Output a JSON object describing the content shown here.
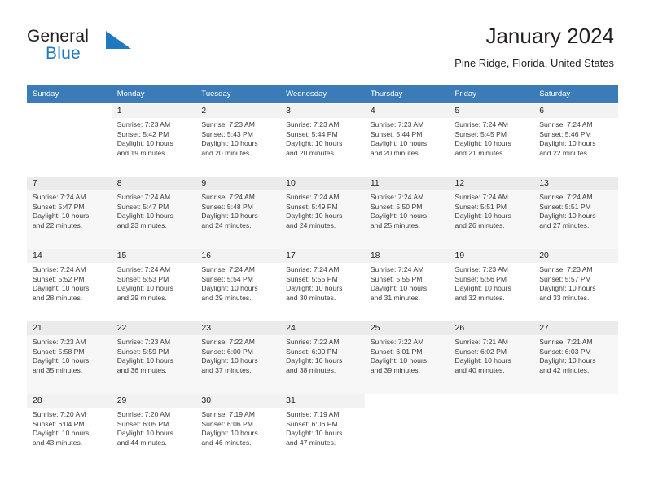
{
  "brand": {
    "name_part1": "General",
    "name_part2": "Blue",
    "flag_icon": "flag-triangle-icon",
    "accent_color": "#1f79c0"
  },
  "header": {
    "title": "January 2024",
    "subtitle": "Pine Ridge, Florida, United States"
  },
  "calendar": {
    "header_bg": "#3b7cb8",
    "weekdays": [
      "Sunday",
      "Monday",
      "Tuesday",
      "Wednesday",
      "Thursday",
      "Friday",
      "Saturday"
    ],
    "weeks": [
      [
        {
          "day": "",
          "sunrise": "",
          "sunset": "",
          "daylight1": "",
          "daylight2": ""
        },
        {
          "day": "1",
          "sunrise": "Sunrise: 7:23 AM",
          "sunset": "Sunset: 5:42 PM",
          "daylight1": "Daylight: 10 hours",
          "daylight2": "and 19 minutes."
        },
        {
          "day": "2",
          "sunrise": "Sunrise: 7:23 AM",
          "sunset": "Sunset: 5:43 PM",
          "daylight1": "Daylight: 10 hours",
          "daylight2": "and 20 minutes."
        },
        {
          "day": "3",
          "sunrise": "Sunrise: 7:23 AM",
          "sunset": "Sunset: 5:44 PM",
          "daylight1": "Daylight: 10 hours",
          "daylight2": "and 20 minutes."
        },
        {
          "day": "4",
          "sunrise": "Sunrise: 7:23 AM",
          "sunset": "Sunset: 5:44 PM",
          "daylight1": "Daylight: 10 hours",
          "daylight2": "and 20 minutes."
        },
        {
          "day": "5",
          "sunrise": "Sunrise: 7:24 AM",
          "sunset": "Sunset: 5:45 PM",
          "daylight1": "Daylight: 10 hours",
          "daylight2": "and 21 minutes."
        },
        {
          "day": "6",
          "sunrise": "Sunrise: 7:24 AM",
          "sunset": "Sunset: 5:46 PM",
          "daylight1": "Daylight: 10 hours",
          "daylight2": "and 22 minutes."
        }
      ],
      [
        {
          "day": "7",
          "sunrise": "Sunrise: 7:24 AM",
          "sunset": "Sunset: 5:47 PM",
          "daylight1": "Daylight: 10 hours",
          "daylight2": "and 22 minutes."
        },
        {
          "day": "8",
          "sunrise": "Sunrise: 7:24 AM",
          "sunset": "Sunset: 5:47 PM",
          "daylight1": "Daylight: 10 hours",
          "daylight2": "and 23 minutes."
        },
        {
          "day": "9",
          "sunrise": "Sunrise: 7:24 AM",
          "sunset": "Sunset: 5:48 PM",
          "daylight1": "Daylight: 10 hours",
          "daylight2": "and 24 minutes."
        },
        {
          "day": "10",
          "sunrise": "Sunrise: 7:24 AM",
          "sunset": "Sunset: 5:49 PM",
          "daylight1": "Daylight: 10 hours",
          "daylight2": "and 24 minutes."
        },
        {
          "day": "11",
          "sunrise": "Sunrise: 7:24 AM",
          "sunset": "Sunset: 5:50 PM",
          "daylight1": "Daylight: 10 hours",
          "daylight2": "and 25 minutes."
        },
        {
          "day": "12",
          "sunrise": "Sunrise: 7:24 AM",
          "sunset": "Sunset: 5:51 PM",
          "daylight1": "Daylight: 10 hours",
          "daylight2": "and 26 minutes."
        },
        {
          "day": "13",
          "sunrise": "Sunrise: 7:24 AM",
          "sunset": "Sunset: 5:51 PM",
          "daylight1": "Daylight: 10 hours",
          "daylight2": "and 27 minutes."
        }
      ],
      [
        {
          "day": "14",
          "sunrise": "Sunrise: 7:24 AM",
          "sunset": "Sunset: 5:52 PM",
          "daylight1": "Daylight: 10 hours",
          "daylight2": "and 28 minutes."
        },
        {
          "day": "15",
          "sunrise": "Sunrise: 7:24 AM",
          "sunset": "Sunset: 5:53 PM",
          "daylight1": "Daylight: 10 hours",
          "daylight2": "and 29 minutes."
        },
        {
          "day": "16",
          "sunrise": "Sunrise: 7:24 AM",
          "sunset": "Sunset: 5:54 PM",
          "daylight1": "Daylight: 10 hours",
          "daylight2": "and 29 minutes."
        },
        {
          "day": "17",
          "sunrise": "Sunrise: 7:24 AM",
          "sunset": "Sunset: 5:55 PM",
          "daylight1": "Daylight: 10 hours",
          "daylight2": "and 30 minutes."
        },
        {
          "day": "18",
          "sunrise": "Sunrise: 7:24 AM",
          "sunset": "Sunset: 5:55 PM",
          "daylight1": "Daylight: 10 hours",
          "daylight2": "and 31 minutes."
        },
        {
          "day": "19",
          "sunrise": "Sunrise: 7:23 AM",
          "sunset": "Sunset: 5:56 PM",
          "daylight1": "Daylight: 10 hours",
          "daylight2": "and 32 minutes."
        },
        {
          "day": "20",
          "sunrise": "Sunrise: 7:23 AM",
          "sunset": "Sunset: 5:57 PM",
          "daylight1": "Daylight: 10 hours",
          "daylight2": "and 33 minutes."
        }
      ],
      [
        {
          "day": "21",
          "sunrise": "Sunrise: 7:23 AM",
          "sunset": "Sunset: 5:58 PM",
          "daylight1": "Daylight: 10 hours",
          "daylight2": "and 35 minutes."
        },
        {
          "day": "22",
          "sunrise": "Sunrise: 7:23 AM",
          "sunset": "Sunset: 5:59 PM",
          "daylight1": "Daylight: 10 hours",
          "daylight2": "and 36 minutes."
        },
        {
          "day": "23",
          "sunrise": "Sunrise: 7:22 AM",
          "sunset": "Sunset: 6:00 PM",
          "daylight1": "Daylight: 10 hours",
          "daylight2": "and 37 minutes."
        },
        {
          "day": "24",
          "sunrise": "Sunrise: 7:22 AM",
          "sunset": "Sunset: 6:00 PM",
          "daylight1": "Daylight: 10 hours",
          "daylight2": "and 38 minutes."
        },
        {
          "day": "25",
          "sunrise": "Sunrise: 7:22 AM",
          "sunset": "Sunset: 6:01 PM",
          "daylight1": "Daylight: 10 hours",
          "daylight2": "and 39 minutes."
        },
        {
          "day": "26",
          "sunrise": "Sunrise: 7:21 AM",
          "sunset": "Sunset: 6:02 PM",
          "daylight1": "Daylight: 10 hours",
          "daylight2": "and 40 minutes."
        },
        {
          "day": "27",
          "sunrise": "Sunrise: 7:21 AM",
          "sunset": "Sunset: 6:03 PM",
          "daylight1": "Daylight: 10 hours",
          "daylight2": "and 42 minutes."
        }
      ],
      [
        {
          "day": "28",
          "sunrise": "Sunrise: 7:20 AM",
          "sunset": "Sunset: 6:04 PM",
          "daylight1": "Daylight: 10 hours",
          "daylight2": "and 43 minutes."
        },
        {
          "day": "29",
          "sunrise": "Sunrise: 7:20 AM",
          "sunset": "Sunset: 6:05 PM",
          "daylight1": "Daylight: 10 hours",
          "daylight2": "and 44 minutes."
        },
        {
          "day": "30",
          "sunrise": "Sunrise: 7:19 AM",
          "sunset": "Sunset: 6:06 PM",
          "daylight1": "Daylight: 10 hours",
          "daylight2": "and 46 minutes."
        },
        {
          "day": "31",
          "sunrise": "Sunrise: 7:19 AM",
          "sunset": "Sunset: 6:06 PM",
          "daylight1": "Daylight: 10 hours",
          "daylight2": "and 47 minutes."
        },
        {
          "day": "",
          "sunrise": "",
          "sunset": "",
          "daylight1": "",
          "daylight2": ""
        },
        {
          "day": "",
          "sunrise": "",
          "sunset": "",
          "daylight1": "",
          "daylight2": ""
        },
        {
          "day": "",
          "sunrise": "",
          "sunset": "",
          "daylight1": "",
          "daylight2": ""
        }
      ]
    ]
  }
}
